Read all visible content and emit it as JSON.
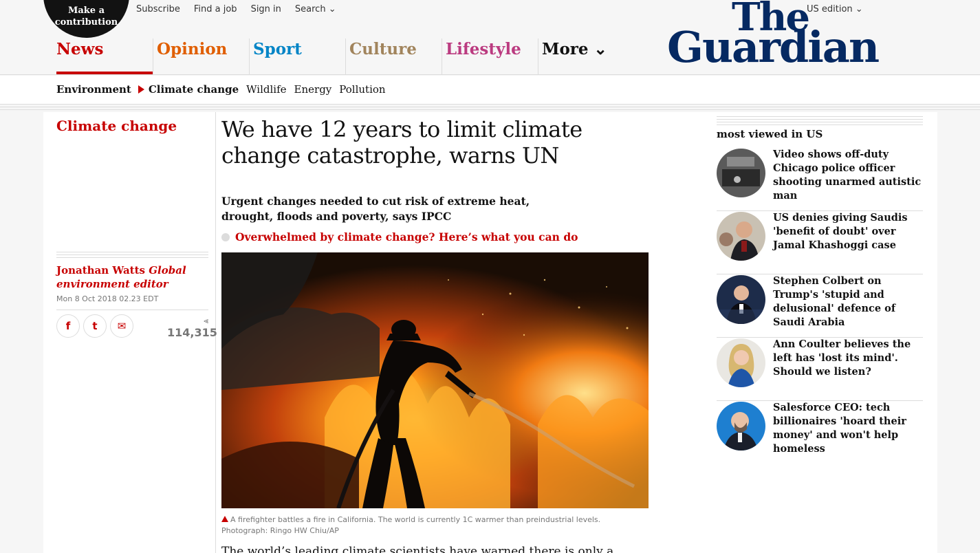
{
  "header": {
    "contribute": "Make a contribution",
    "links": [
      "Subscribe",
      "Find a job",
      "Sign in",
      "Search ⌄"
    ],
    "edition": "US edition ⌄",
    "logo_line1": "The",
    "logo_line2": "Guardian",
    "pillars": [
      "News",
      "Opinion",
      "Sport",
      "Culture",
      "Lifestyle",
      "More ⌄"
    ]
  },
  "subnav": {
    "parent": "Environment",
    "current": "Climate change",
    "siblings": [
      "Wildlife",
      "Energy",
      "Pollution"
    ]
  },
  "article": {
    "section": "Climate change",
    "author": "Jonathan Watts",
    "role": "Global environment editor",
    "date": "Mon 8 Oct 2018 02.23 EDT",
    "share_count": "114,315",
    "headline": "We have 12 years to limit climate change catastrophe, warns UN",
    "standfirst": "Urgent changes needed to cut risk of extreme heat, drought, floods and poverty, says IPCC",
    "related_link": "Overwhelmed by climate change? Here’s what you can do",
    "caption": "A firefighter battles a fire in California. The world is currently 1C warmer than preindustrial levels. Photograph: Ringo HW Chiu/AP",
    "body_start": "The world’s leading climate scientists have warned there is only a dozen"
  },
  "share_icons": [
    "f",
    "t",
    "✉"
  ],
  "most_viewed": {
    "title": "most viewed in US",
    "items": [
      "Video shows off-duty Chicago police officer shooting unarmed autistic man",
      "US denies giving Saudis 'benefit of doubt' over Jamal Khashoggi case",
      "Stephen Colbert on Trump's 'stupid and delusional' defence of Saudi Arabia",
      "Ann Coulter believes the left has 'lost its mind'. Should we listen?",
      "Salesforce CEO: tech billionaires 'hoard their money' and won't help homeless"
    ]
  }
}
